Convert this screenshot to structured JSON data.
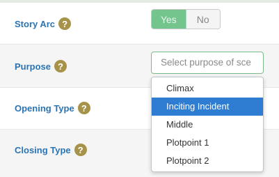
{
  "story_arc": {
    "label": "Story Arc",
    "help_icon": "question-mark-icon",
    "options": [
      "Yes",
      "No"
    ],
    "selected": "Yes"
  },
  "purpose": {
    "label": "Purpose",
    "help_icon": "question-mark-icon",
    "placeholder": "Select purpose of sce",
    "options": [
      "Climax",
      "Inciting Incident",
      "Middle",
      "Plotpoint 1",
      "Plotpoint 2"
    ],
    "highlighted": "Inciting Incident"
  },
  "opening_type": {
    "label": "Opening Type",
    "help_icon": "question-mark-icon"
  },
  "closing_type": {
    "label": "Closing Type",
    "help_icon": "question-mark-icon"
  },
  "colors": {
    "label_blue": "#2a74b4",
    "help_gold": "#a69248",
    "toggle_green": "#74c48d",
    "highlight_blue": "#2e7dd3"
  }
}
